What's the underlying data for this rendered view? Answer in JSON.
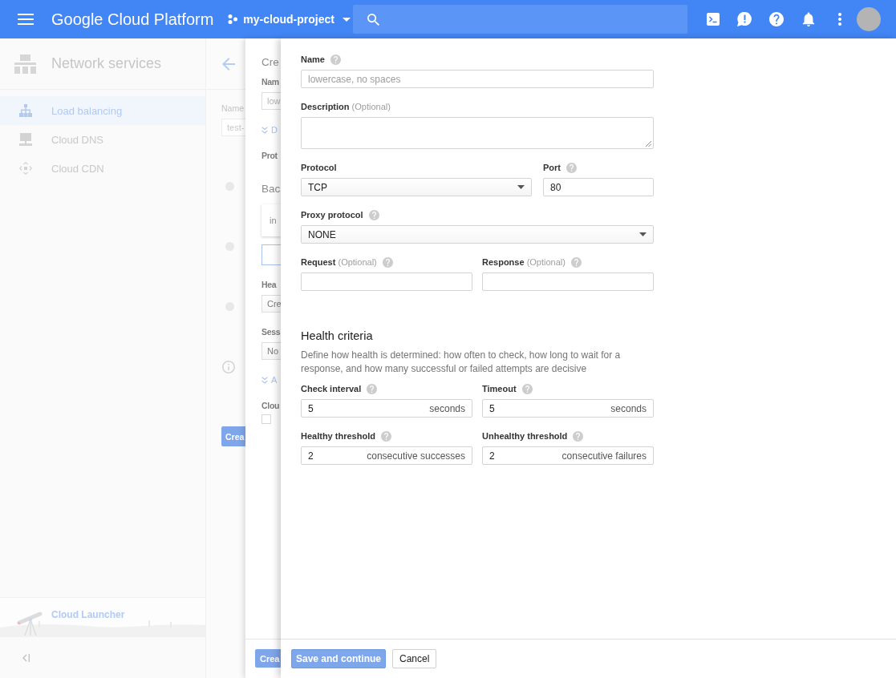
{
  "top_bar": {
    "title": "Google Cloud Platform",
    "project": "my-cloud-project"
  },
  "sidebar": {
    "title": "Network services",
    "items": [
      {
        "label": "Load balancing",
        "selected": true
      },
      {
        "label": "Cloud DNS",
        "selected": false
      },
      {
        "label": "Cloud CDN",
        "selected": false
      }
    ],
    "promo": "Cloud Launcher"
  },
  "background_page": {
    "name_label": "Name",
    "name_value": "test-",
    "steps": [
      {
        "complete": false
      },
      {
        "complete": false
      },
      {
        "complete": false
      }
    ],
    "button": "Crea"
  },
  "middle_panel": {
    "title": "Cre",
    "items": [
      {
        "kind": "label",
        "text": "Nam"
      },
      {
        "kind": "input",
        "placeholder": "low",
        "focused": false
      },
      {
        "kind": "link",
        "text": "D"
      },
      {
        "kind": "label",
        "text": "Prot"
      },
      {
        "kind": "heading",
        "text": "Bac"
      },
      {
        "kind": "card",
        "text": "in"
      },
      {
        "kind": "input",
        "focused": true
      },
      {
        "kind": "label",
        "text": "Hea"
      },
      {
        "kind": "select",
        "value": "Cre"
      },
      {
        "kind": "label",
        "text": "Sess"
      },
      {
        "kind": "select",
        "value": "No"
      },
      {
        "kind": "link",
        "text": "A"
      },
      {
        "kind": "label",
        "text": "Clou"
      },
      {
        "kind": "checkbox",
        "checked": false
      }
    ],
    "button": "Crea"
  },
  "form": {
    "rows": [
      {
        "fields": [
          {
            "kind": "text",
            "label": "Name",
            "help": true,
            "placeholder": "lowercase, no spaces"
          }
        ]
      },
      {
        "fields": [
          {
            "kind": "textarea",
            "label": "Description",
            "note": "(Optional)",
            "help": false
          }
        ]
      },
      {
        "fields": [
          {
            "kind": "select",
            "label": "Protocol",
            "help": false,
            "value": "TCP"
          },
          {
            "kind": "text",
            "label": "Port",
            "help": true,
            "value": "80"
          }
        ]
      },
      {
        "fields": [
          {
            "kind": "select",
            "label": "Proxy protocol",
            "help": true,
            "value": "NONE"
          }
        ]
      },
      {
        "fields": [
          {
            "kind": "text",
            "label": "Request",
            "note": "(Optional)",
            "help": true
          },
          {
            "kind": "text",
            "label": "Response",
            "note": "(Optional)",
            "help": true
          }
        ]
      }
    ],
    "health_criteria": {
      "title": "Health criteria",
      "description": "Define how health is determined: how often to check, how long to wait for a response, and how many successful or failed attempts are decisive",
      "rows": [
        {
          "fields": [
            {
              "kind": "text",
              "label": "Check interval",
              "help": true,
              "value": "5",
              "unit": "seconds"
            },
            {
              "kind": "text",
              "label": "Timeout",
              "help": true,
              "value": "5",
              "unit": "seconds"
            }
          ]
        },
        {
          "fields": [
            {
              "kind": "text",
              "label": "Healthy threshold",
              "help": true,
              "value": "2",
              "unit": "consecutive successes"
            },
            {
              "kind": "text",
              "label": "Unhealthy threshold",
              "help": true,
              "value": "2",
              "unit": "consecutive failures"
            }
          ]
        }
      ]
    }
  },
  "footer": {
    "buttons": [
      {
        "label": "Save and continue",
        "kind": "primary",
        "disabled": true
      },
      {
        "label": "Cancel",
        "kind": "secondary",
        "disabled": false
      }
    ]
  }
}
